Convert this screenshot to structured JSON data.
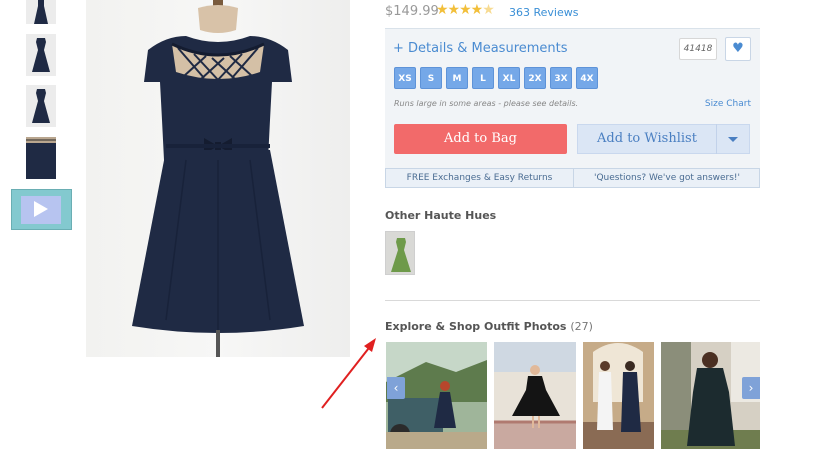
{
  "product": {
    "price": "$149.99",
    "rating_stars": 4.5,
    "reviews_link": "363 Reviews"
  },
  "details": {
    "link_label": "+ Details & Measurements",
    "counter": "41418",
    "heart_icon": "heart-icon",
    "sizes": [
      "XS",
      "S",
      "M",
      "L",
      "XL",
      "2X",
      "3X",
      "4X"
    ],
    "fit_note": "Runs large in some areas - please see details.",
    "size_chart_link": "Size Chart",
    "add_to_bag": "Add to Bag",
    "add_to_wishlist": "Add to Wishlist"
  },
  "info_bar": {
    "exchanges": "FREE Exchanges & Easy Returns",
    "questions": "'Questions? We've got answers!'"
  },
  "hues": {
    "title": "Other Haute Hues"
  },
  "outfits": {
    "title": "Explore & Shop Outfit Photos",
    "count": "(27)",
    "prev_icon": "chevron-left-icon",
    "next_icon": "chevron-right-icon"
  },
  "colors": {
    "dress_navy": "#1f2a44",
    "accent_blue": "#4a8bd1",
    "add_to_bag": "#f26a6a",
    "annotation_red": "#e02020",
    "star": "#f2bf3a"
  }
}
